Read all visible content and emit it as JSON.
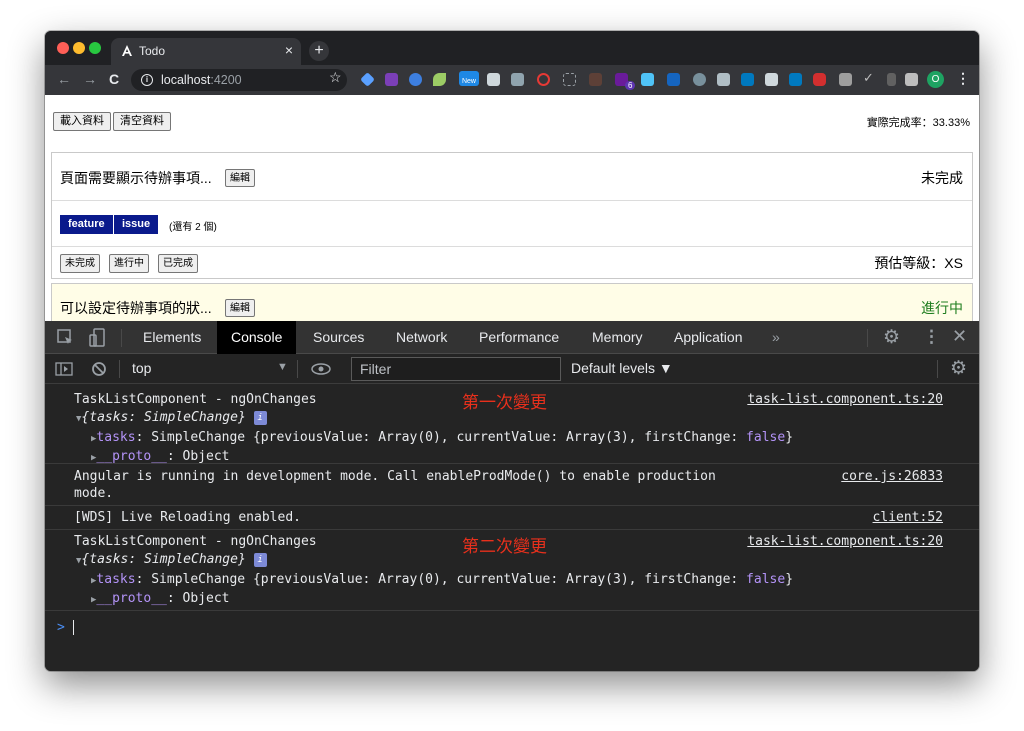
{
  "browser": {
    "tab_title": "Todo",
    "tab_close": "×",
    "new_tab": "+",
    "url_host": "localhost",
    "url_port": ":4200",
    "info_glyph": "i",
    "profile_initial": "O",
    "kebab": "⋮",
    "extensions": [
      "diamond-ext-icon",
      "onenote-ext-icon",
      "sync-ext-icon",
      "leaf-ext-icon",
      "new-badge-ext-icon",
      "lock-ext-icon",
      "mail-ext-icon",
      "block-ext-icon",
      "crop-ext-icon",
      "notes-ext-icon",
      "tree-ext-icon",
      "puzzle-ext-icon",
      "chart-ext-icon",
      "tag-ext-icon",
      "shield-ext-icon",
      "trello-ext-icon",
      "board-ext-icon",
      "trello2-ext-icon",
      "abp-ext-icon",
      "image-ext-icon",
      "check-ext-icon",
      "phone-ext-icon",
      "extensions-icon"
    ],
    "new_badge": "New",
    "count_badge": "6"
  },
  "page": {
    "load_button": "載入資料",
    "clear_button": "清空資料",
    "completion_rate": "實際完成率：33.33%",
    "tasks": [
      {
        "title": "頁面需要顯示待辦事項...",
        "edit_label": "編輯",
        "status": "未完成",
        "status_color": "#000000",
        "tags": [
          "feature",
          "issue"
        ],
        "more": "(還有 2 個)",
        "state_buttons": [
          "未完成",
          "進行中",
          "已完成"
        ],
        "level": "預估等級：XS"
      },
      {
        "title": "可以設定待辦事項的狀...",
        "edit_label": "編輯",
        "status": "進行中",
        "status_color": "#1e7d1e"
      }
    ]
  },
  "devtools": {
    "tabs": [
      "Elements",
      "Console",
      "Sources",
      "Network",
      "Performance",
      "Memory",
      "Application"
    ],
    "active_tab": "Console",
    "more_tabs": "»",
    "context": "top",
    "filter_placeholder": "Filter",
    "levels": "Default levels ▼",
    "messages": [
      {
        "title": "TaskListComponent - ngOnChanges",
        "source": "task-list.component.ts:20",
        "obj": "{tasks: SimpleChange}",
        "badge": "i",
        "prop_key": "tasks",
        "prop_val": "SimpleChange {previousValue: Array(0), currentValue: Array(3), firstChange:",
        "prop_bool": "false",
        "prop_close": "}",
        "proto_key": "__proto__",
        "proto_val": ": Object",
        "annotation": "第一次變更"
      },
      {
        "line1": "Angular is running in development mode. Call enableProdMode() to enable production",
        "line2": "mode.",
        "source": "core.js:26833"
      },
      {
        "line1": "[WDS] Live Reloading enabled.",
        "source": "client:52"
      },
      {
        "title": "TaskListComponent - ngOnChanges",
        "source": "task-list.component.ts:20",
        "obj": "{tasks: SimpleChange}",
        "badge": "i",
        "prop_key": "tasks",
        "prop_val": "SimpleChange {previousValue: Array(0), currentValue: Array(3), firstChange:",
        "prop_bool": "false",
        "prop_close": "}",
        "proto_key": "__proto__",
        "proto_val": ": Object",
        "annotation": "第二次變更"
      }
    ],
    "prompt": ">"
  }
}
